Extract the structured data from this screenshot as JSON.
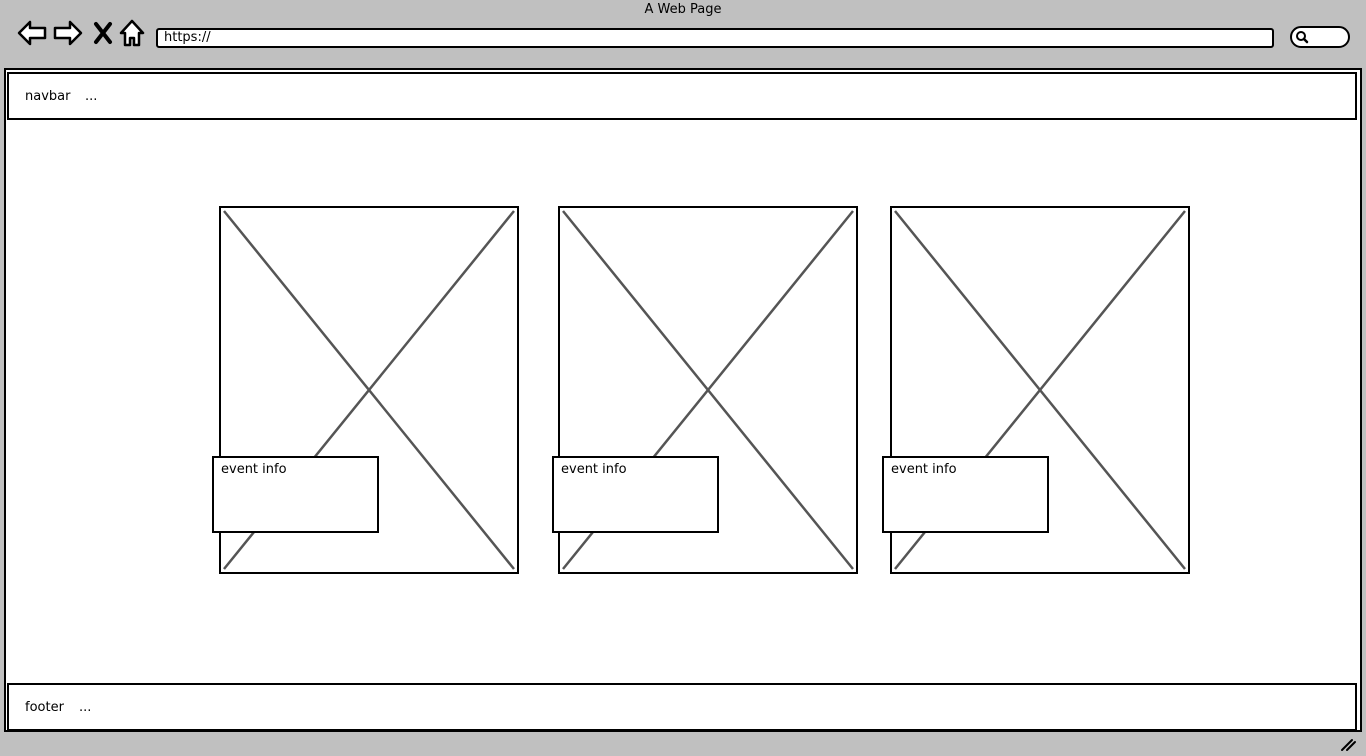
{
  "window": {
    "title": "A Web Page"
  },
  "toolbar": {
    "url": "https://"
  },
  "navbar": {
    "label": "navbar",
    "extra": "..."
  },
  "cards": [
    {
      "info_label": "event info"
    },
    {
      "info_label": "event info"
    },
    {
      "info_label": "event info"
    }
  ],
  "footer": {
    "label": "footer",
    "extra": "..."
  }
}
